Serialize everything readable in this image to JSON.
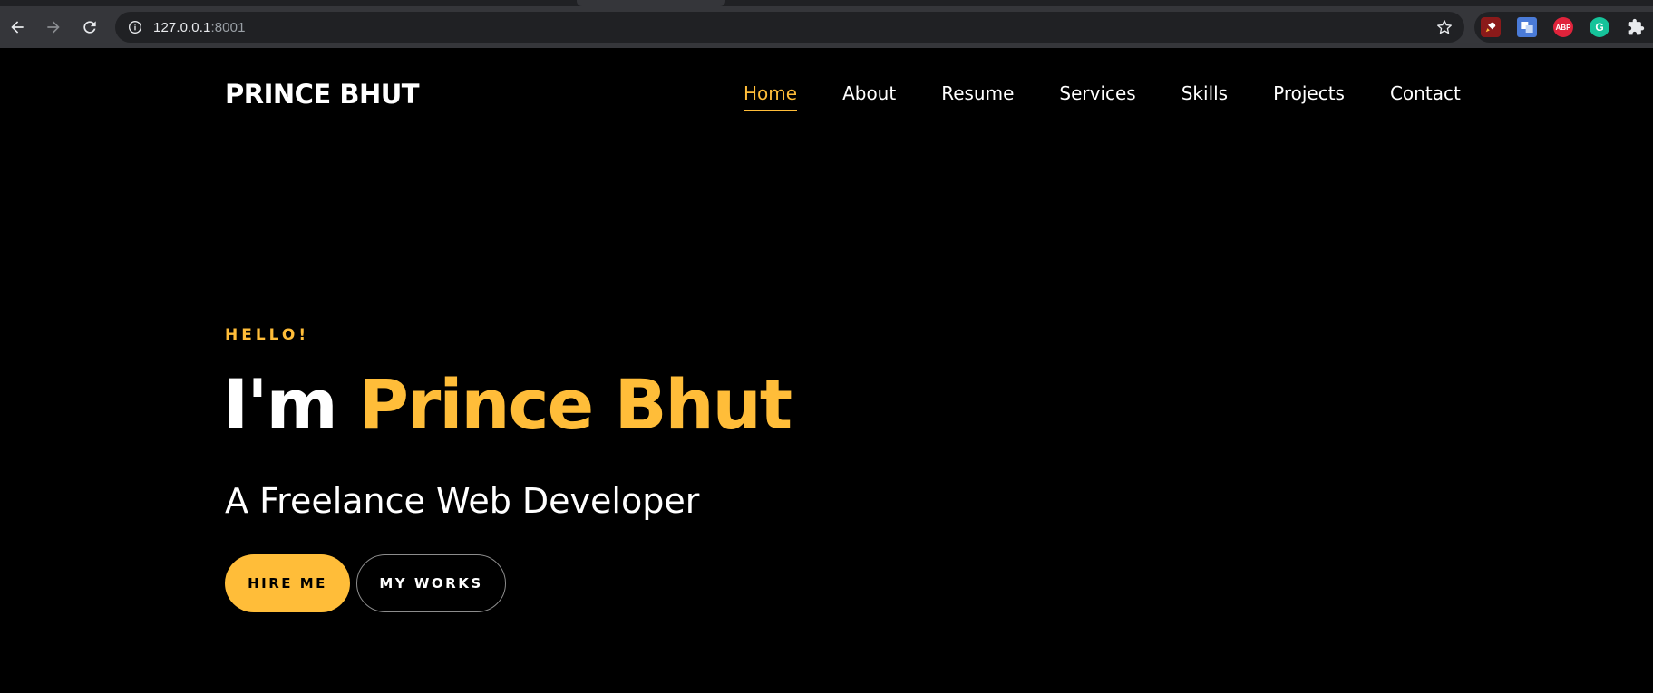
{
  "browser": {
    "url_host": "127.0.0.1",
    "url_port": ":8001",
    "icons": {
      "back": "arrow-left-icon",
      "forward": "arrow-right-icon",
      "reload": "reload-icon",
      "info": "info-icon",
      "bookmark": "star-icon"
    },
    "extensions": {
      "abp_label": "ABP",
      "grammarly_label": "G"
    }
  },
  "site": {
    "logo": "PRINCE BHUT",
    "nav": [
      {
        "label": "Home",
        "active": true
      },
      {
        "label": "About"
      },
      {
        "label": "Resume"
      },
      {
        "label": "Services"
      },
      {
        "label": "Skills"
      },
      {
        "label": "Projects"
      },
      {
        "label": "Contact"
      }
    ],
    "hero": {
      "greeting": "HELLO!",
      "headline_prefix": "I'm ",
      "headline_name": "Prince Bhut",
      "subtitle": "A Freelance Web Developer",
      "primary_button": "HIRE ME",
      "secondary_button": "MY WORKS"
    },
    "colors": {
      "accent": "#ffbd39",
      "background": "#000000",
      "text": "#ffffff"
    }
  }
}
